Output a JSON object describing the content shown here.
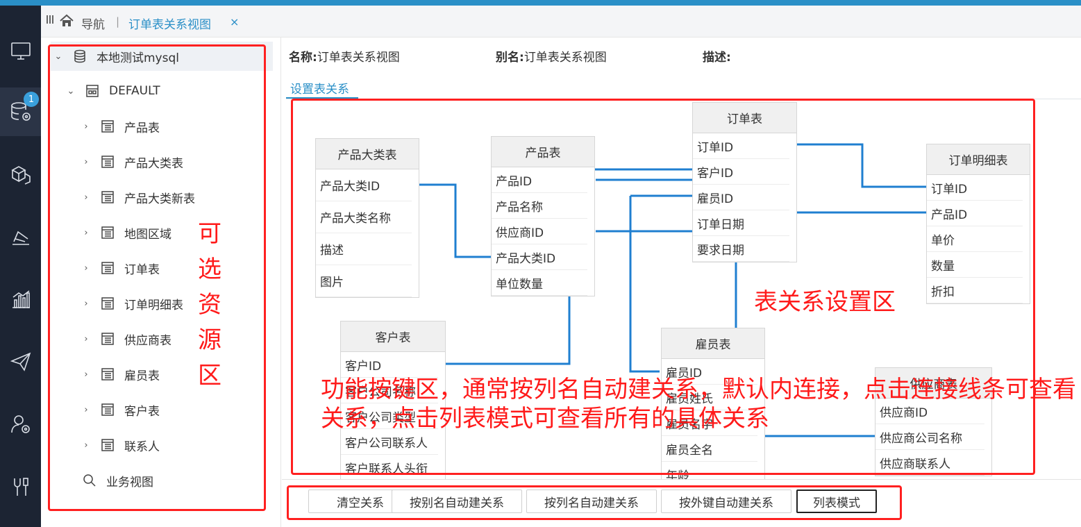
{
  "tabbar": {
    "nav_label": "导航",
    "separator": "|",
    "tab_label": "订单表关系视图",
    "close": "×"
  },
  "leftnav": {
    "badge": "1"
  },
  "sidebar": {
    "root": "本地测试mysql",
    "schema": "DEFAULT",
    "tables": [
      "产品表",
      "产品大类表",
      "产品大类新表",
      "地图区域",
      "订单表",
      "订单明细表",
      "供应商表",
      "雇员表",
      "客户表",
      "联系人"
    ],
    "business_view": "业务视图"
  },
  "info": {
    "name_label": "名称:",
    "name_value": "订单表关系视图",
    "alias_label": "别名:",
    "alias_value": "订单表关系视图",
    "desc_label": "描述:"
  },
  "subtab": "设置表关系",
  "tables": {
    "t_category": {
      "title": "产品大类表",
      "cols": [
        "产品大类ID",
        "产品大类名称",
        "描述",
        "图片"
      ]
    },
    "t_product": {
      "title": "产品表",
      "cols": [
        "产品ID",
        "产品名称",
        "供应商ID",
        "产品大类ID",
        "单位数量"
      ]
    },
    "t_order": {
      "title": "订单表",
      "cols": [
        "订单ID",
        "客户ID",
        "雇员ID",
        "订单日期",
        "要求日期"
      ]
    },
    "t_detail": {
      "title": "订单明细表",
      "cols": [
        "订单ID",
        "产品ID",
        "单价",
        "数量",
        "折扣"
      ]
    },
    "t_customer": {
      "title": "客户表",
      "cols": [
        "客户ID",
        "客户公司名称",
        "客户公司类型",
        "客户公司联系人",
        "客户联系人头衔"
      ]
    },
    "t_employee": {
      "title": "雇员表",
      "cols": [
        "雇员ID",
        "雇员姓氏",
        "雇员名字",
        "雇员全名",
        "年龄"
      ]
    },
    "t_supplier": {
      "title": "供应商表",
      "cols": [
        "供应商ID",
        "供应商公司名称",
        "供应商联系人"
      ]
    }
  },
  "buttons": [
    "清空关系",
    "按别名自动建关系",
    "按列名自动建关系",
    "按外键自动建关系",
    "列表模式"
  ],
  "annotations": {
    "sidebar_note": "可选资源区",
    "canvas_note": "表关系设置区",
    "button_note": "功能按键区，通常按列名自动建关系，默认内连接，点击连接线条可查看关系，点击列表模式可查看所有的具体关系"
  },
  "colors": {
    "accent": "#2a8fc7",
    "nav_bg": "#1c2433",
    "annotation": "#ff1a1a",
    "relation_line": "#1f7fd0"
  }
}
